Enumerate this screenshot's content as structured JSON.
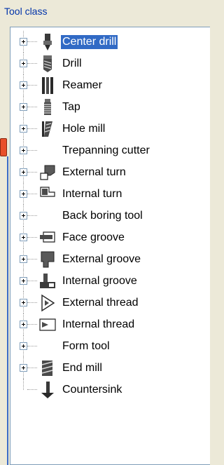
{
  "panel": {
    "title": "Tool class"
  },
  "tree": {
    "items": [
      {
        "label": "Center drill",
        "icon": "center-drill-icon",
        "expander": true,
        "selected": true
      },
      {
        "label": "Drill",
        "icon": "drill-icon",
        "expander": true,
        "selected": false
      },
      {
        "label": "Reamer",
        "icon": "reamer-icon",
        "expander": true,
        "selected": false
      },
      {
        "label": "Tap",
        "icon": "tap-icon",
        "expander": true,
        "selected": false
      },
      {
        "label": "Hole mill",
        "icon": "hole-mill-icon",
        "expander": true,
        "selected": false
      },
      {
        "label": "Trepanning cutter",
        "icon": "",
        "expander": true,
        "selected": false
      },
      {
        "label": "External turn",
        "icon": "external-turn-icon",
        "expander": true,
        "selected": false
      },
      {
        "label": "Internal turn",
        "icon": "internal-turn-icon",
        "expander": true,
        "selected": false
      },
      {
        "label": "Back boring tool",
        "icon": "",
        "expander": true,
        "selected": false
      },
      {
        "label": "Face groove",
        "icon": "face-groove-icon",
        "expander": true,
        "selected": false
      },
      {
        "label": "External groove",
        "icon": "external-groove-icon",
        "expander": true,
        "selected": false
      },
      {
        "label": "Internal groove",
        "icon": "internal-groove-icon",
        "expander": true,
        "selected": false
      },
      {
        "label": "External thread",
        "icon": "external-thread-icon",
        "expander": true,
        "selected": false
      },
      {
        "label": "Internal thread",
        "icon": "internal-thread-icon",
        "expander": true,
        "selected": false
      },
      {
        "label": "Form tool",
        "icon": "",
        "expander": true,
        "selected": false
      },
      {
        "label": "End mill",
        "icon": "end-mill-icon",
        "expander": true,
        "selected": false
      },
      {
        "label": "Countersink",
        "icon": "countersink-icon",
        "expander": false,
        "selected": false
      }
    ]
  },
  "colors": {
    "title_text": "#0033aa",
    "selection_bg": "#316ac5",
    "selection_text": "#ffffff",
    "tree_border": "#7f9db9",
    "panel_bg": "#ece9d8"
  }
}
